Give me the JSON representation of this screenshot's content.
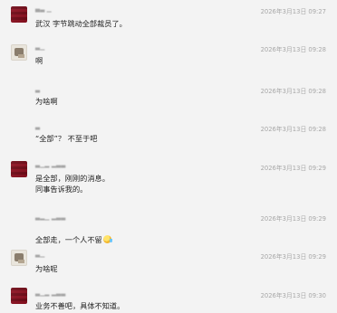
{
  "messages": [
    {
      "sender": "▄▃ ▁",
      "time": "2026年3月13日 09:27",
      "text": "武汉 字节跳动全部裁员了。"
    },
    {
      "sender": "▃▁",
      "time": "2026年3月13日 09:28",
      "text": "啊"
    },
    {
      "sender": "▃",
      "time": "2026年3月13日 09:28",
      "text": "为啥啊"
    },
    {
      "sender": "▃",
      "time": "2026年3月13日 09:28",
      "text": "“全部”？ 不至于吧"
    },
    {
      "sender": "▃▁▂ ▂▃▃",
      "time": "2026年3月13日 09:29",
      "text": "是全部，刚刚的消息。\n同事告诉我的。"
    },
    {
      "sender": "▃▂▁ ▂▃▃",
      "time": "2026年3月13日 09:29",
      "text": "全部走，一个人不留"
    },
    {
      "sender": "▃▁",
      "time": "2026年3月13日 09:29",
      "text": "为啥呢"
    },
    {
      "sender": "▃▁▂ ▂▃▃",
      "time": "2026年3月13日 09:30",
      "text": "业务不善吧，具体不知道。"
    }
  ]
}
